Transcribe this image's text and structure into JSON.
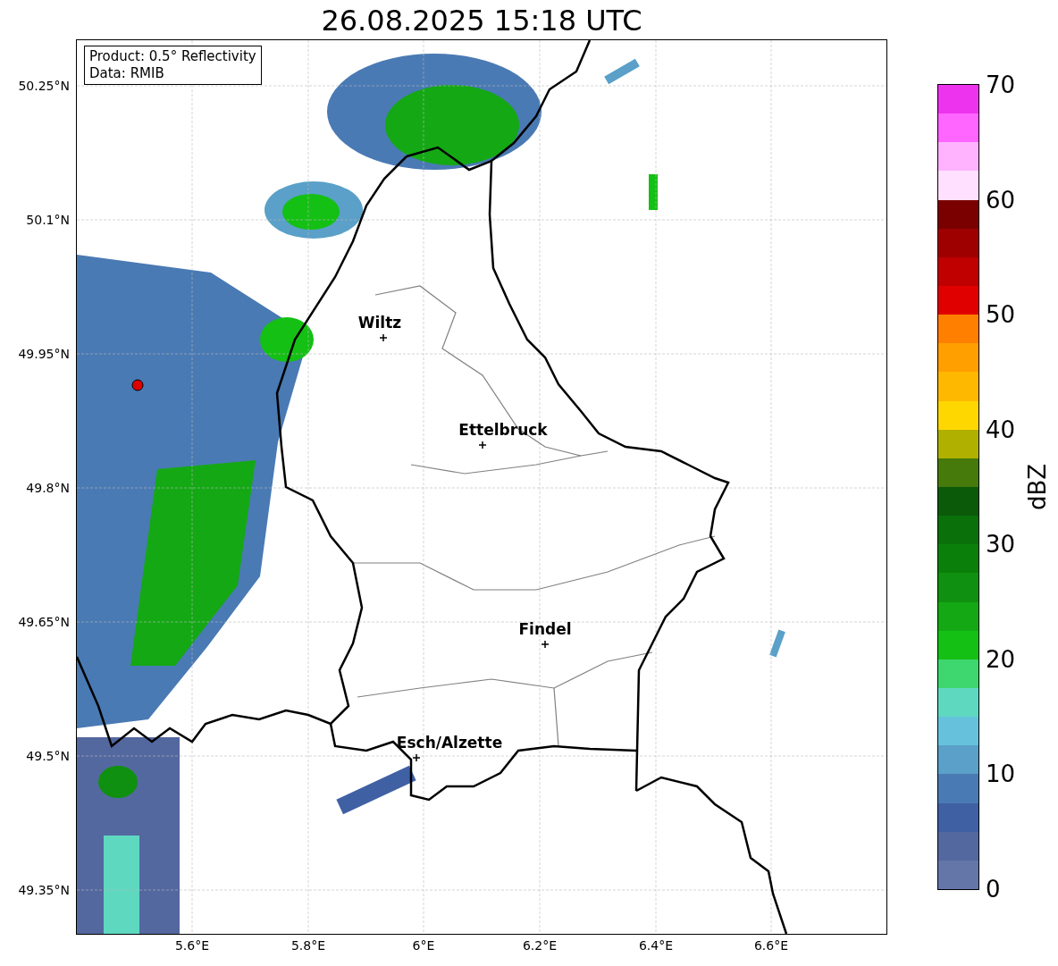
{
  "title": "26.08.2025 15:18 UTC",
  "info_box": {
    "lines": [
      "Product: 0.5° Reflectivity",
      "Data: RMIB"
    ]
  },
  "cities": [
    {
      "name": "Wiltz"
    },
    {
      "name": "Ettelbruck"
    },
    {
      "name": "Findel"
    },
    {
      "name": "Esch/Alzette"
    }
  ],
  "x_ticks": [
    "5.6°E",
    "5.8°E",
    "6°E",
    "6.2°E",
    "6.4°E",
    "6.6°E"
  ],
  "y_ticks": [
    "50.25°N",
    "50.1°N",
    "49.95°N",
    "49.8°N",
    "49.65°N",
    "49.5°N",
    "49.35°N"
  ],
  "colorbar": {
    "label": "dBZ",
    "ticks": [
      "70",
      "60",
      "50",
      "40",
      "30",
      "20",
      "10",
      "0"
    ],
    "segments": [
      {
        "color": "#ee33ee"
      },
      {
        "color": "#ff66ff"
      },
      {
        "color": "#ffb3ff"
      },
      {
        "color": "#ffe0ff"
      },
      {
        "color": "#7a0000"
      },
      {
        "color": "#9e0000"
      },
      {
        "color": "#c00000"
      },
      {
        "color": "#e00000"
      },
      {
        "color": "#ff8000"
      },
      {
        "color": "#ff9f00"
      },
      {
        "color": "#ffb800"
      },
      {
        "color": "#ffd700"
      },
      {
        "color": "#b0b000"
      },
      {
        "color": "#467a0a"
      },
      {
        "color": "#0a5a0a"
      },
      {
        "color": "#0a700a"
      },
      {
        "color": "#0a800a"
      },
      {
        "color": "#109010"
      },
      {
        "color": "#14a814"
      },
      {
        "color": "#14c014"
      },
      {
        "color": "#3ed66e"
      },
      {
        "color": "#5fd8c0"
      },
      {
        "color": "#66c2dc"
      },
      {
        "color": "#5aa0c8"
      },
      {
        "color": "#4a7ab4"
      },
      {
        "color": "#4060a4"
      },
      {
        "color": "#5468a0"
      },
      {
        "color": "#6475a8"
      }
    ]
  }
}
